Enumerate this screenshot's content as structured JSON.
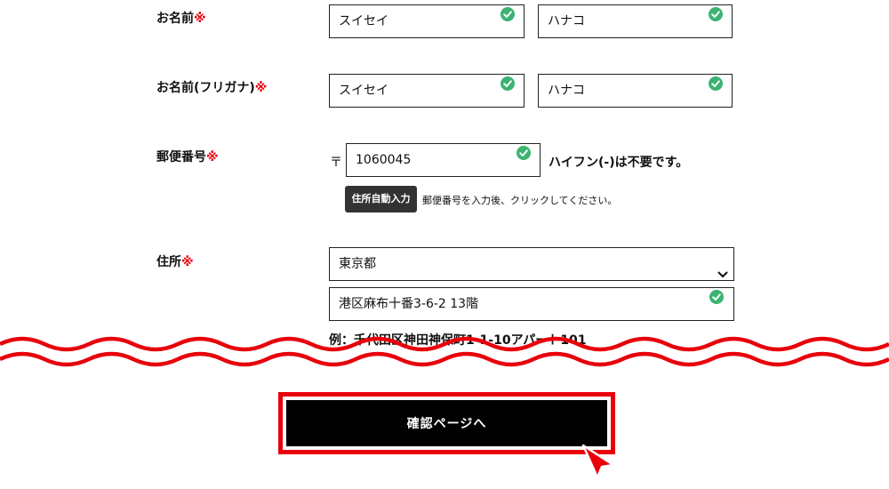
{
  "form": {
    "name": {
      "label": "お名前",
      "required_mark": "※",
      "last": "スイセイ",
      "first": "ハナコ"
    },
    "furigana": {
      "label": "お名前(フリガナ)",
      "required_mark": "※",
      "last": "スイセイ",
      "first": "ハナコ"
    },
    "postal": {
      "label": "郵便番号",
      "required_mark": "※",
      "prefix": "〒",
      "value": "1060045",
      "hint": "ハイフン(-)は不要です。",
      "autofill_label": "住所自動入力",
      "autofill_hint": "郵便番号を入力後、クリックしてください。"
    },
    "address": {
      "label": "住所",
      "required_mark": "※",
      "prefecture": "東京都",
      "street": "港区麻布十番3-6-2 13階",
      "example": "例：千代田区神田神保町1-1-10アパート101"
    }
  },
  "confirm_button": {
    "label": "確認ページへ"
  },
  "colors": {
    "accent_red": "#e8000b",
    "valid_green": "#3cb371",
    "button_black": "#000000"
  },
  "icons": [
    "check-circle-icon",
    "chevron-down-icon",
    "cursor-arrow-icon"
  ]
}
